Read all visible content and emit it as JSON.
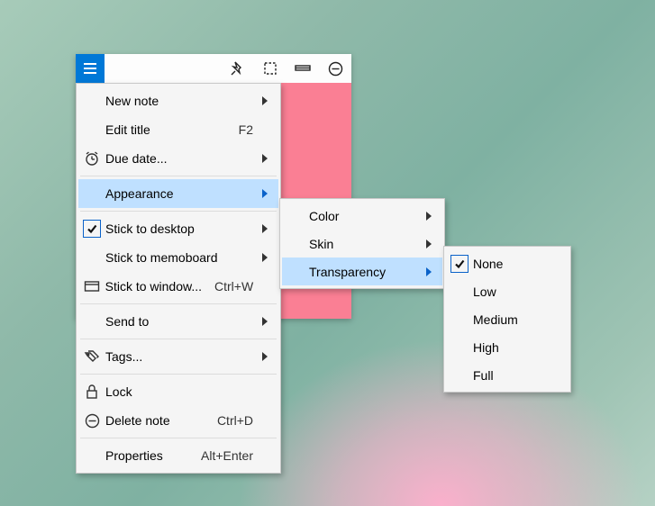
{
  "toolbar": {
    "icons": {
      "hamburger": "menu",
      "pin": "pin",
      "select": "select-area",
      "titlebar": "titlebar",
      "minimize": "minimize-circle"
    }
  },
  "mainMenu": {
    "items": [
      {
        "label": "New note",
        "hasSubmenu": true
      },
      {
        "label": "Edit title",
        "shortcut": "F2"
      },
      {
        "label": "Due date...",
        "icon": "alarm",
        "hasSubmenu": true
      }
    ],
    "appearance": {
      "label": "Appearance",
      "hasSubmenu": true,
      "highlighted": true
    },
    "items2": [
      {
        "label": "Stick to desktop",
        "checked": true,
        "hasSubmenu": true
      },
      {
        "label": "Stick to memoboard",
        "hasSubmenu": true
      },
      {
        "label": "Stick to window...",
        "icon": "window",
        "shortcut": "Ctrl+W"
      }
    ],
    "items3": [
      {
        "label": "Send to",
        "hasSubmenu": true
      }
    ],
    "items4": [
      {
        "label": "Tags...",
        "icon": "tags",
        "hasSubmenu": true
      }
    ],
    "items5": [
      {
        "label": "Lock",
        "icon": "lock"
      },
      {
        "label": "Delete note",
        "icon": "delete-circle",
        "shortcut": "Ctrl+D"
      }
    ],
    "items6": [
      {
        "label": "Properties",
        "shortcut": "Alt+Enter"
      }
    ]
  },
  "appearanceMenu": {
    "items": [
      {
        "label": "Color",
        "hasSubmenu": true
      },
      {
        "label": "Skin",
        "hasSubmenu": true
      }
    ],
    "transparency": {
      "label": "Transparency",
      "hasSubmenu": true,
      "highlighted": true
    }
  },
  "transparencyMenu": {
    "items": [
      {
        "label": "None",
        "checked": true
      },
      {
        "label": "Low"
      },
      {
        "label": "Medium"
      },
      {
        "label": "High"
      },
      {
        "label": "Full"
      }
    ]
  }
}
